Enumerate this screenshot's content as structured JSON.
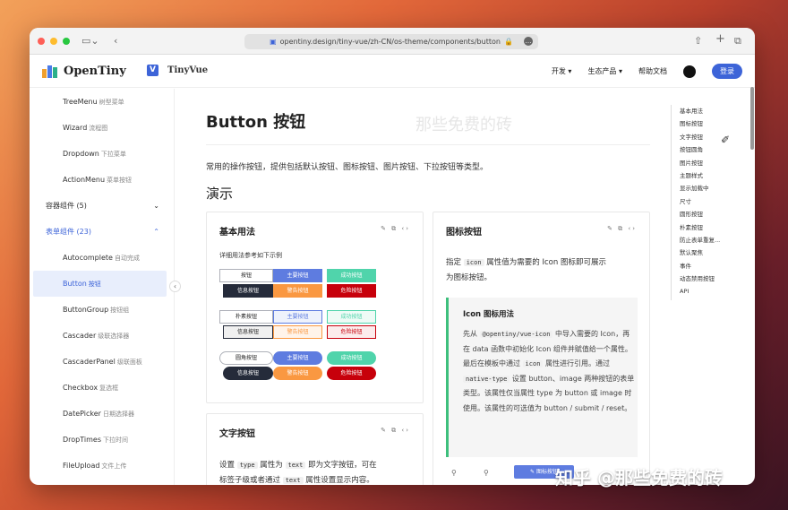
{
  "browser": {
    "url": "opentiny.design/tiny-vue/zh-CN/os-theme/components/button"
  },
  "topnav": {
    "brand": "OpenTiny",
    "product": "TinyVue",
    "items": [
      "开发",
      "生态产品",
      "帮助文档"
    ],
    "login": "登录"
  },
  "sidebar": {
    "items": [
      {
        "en": "TreeMenu",
        "cn": "树型菜单",
        "type": "item"
      },
      {
        "en": "Wizard",
        "cn": "流程图",
        "type": "item"
      },
      {
        "en": "Dropdown",
        "cn": "下拉菜单",
        "type": "item"
      },
      {
        "en": "ActionMenu",
        "cn": "菜单按钮",
        "type": "item"
      },
      {
        "en": "容器组件 (5)",
        "cn": "",
        "type": "group"
      },
      {
        "en": "表单组件 (23)",
        "cn": "",
        "type": "group-open"
      },
      {
        "en": "Autocomplete",
        "cn": "自动完成",
        "type": "item"
      },
      {
        "en": "Button",
        "cn": "按钮",
        "type": "active"
      },
      {
        "en": "ButtonGroup",
        "cn": "按钮组",
        "type": "item"
      },
      {
        "en": "Cascader",
        "cn": "级联选择器",
        "type": "item"
      },
      {
        "en": "CascaderPanel",
        "cn": "级联面板",
        "type": "item"
      },
      {
        "en": "Checkbox",
        "cn": "复选框",
        "type": "item"
      },
      {
        "en": "DatePicker",
        "cn": "日期选择器",
        "type": "item"
      },
      {
        "en": "DropTimes",
        "cn": "下拉时间",
        "type": "item"
      },
      {
        "en": "FileUpload",
        "cn": "文件上传",
        "type": "item"
      }
    ]
  },
  "main": {
    "title": "Button 按钮",
    "watermark": "那些免费的砖",
    "description": "常用的操作按钮，提供包括默认按钮、图标按钮、图片按钮、下拉按钮等类型。",
    "demo_heading": "演示",
    "card_basic": {
      "title": "基本用法",
      "subtitle": "详细用法参考如下示例",
      "row_labels": [
        "按钮",
        "主要按钮",
        "成功按钮",
        "信息按钮",
        "警告按钮",
        "危险按钮"
      ],
      "plain_labels": [
        "朴素按钮",
        "主要按钮",
        "成功按钮",
        "信息按钮",
        "警告按钮",
        "危险按钮"
      ],
      "round_labels": [
        "圆角按钮",
        "主要按钮",
        "成功按钮",
        "信息按钮",
        "警告按钮",
        "危险按钮"
      ]
    },
    "card_text": {
      "title": "文字按钮",
      "p1": "设置",
      "code1": "type",
      "p2": "属性为",
      "code2": "text",
      "p3": "即为文字按钮，可在",
      "p4": "标签子级或者通过",
      "code3": "text",
      "p5": "属性设置显示内容。"
    },
    "card_icon": {
      "title": "图标按钮",
      "p1": "指定",
      "code1": "icon",
      "p2": "属性值为需要的 Icon 图标即可展示",
      "p3": "为图标按钮。",
      "tip_title": "Icon 图标用法",
      "tip_a": "先从",
      "tip_code1": "@opentiny/vue-icon",
      "tip_b": "中导入需要的 Icon，再在 data 函数中初始化 Icon 组件并赋值给一个属性。最后在模板中通过",
      "tip_code2": "icon",
      "tip_c": "属性进行引用。通过",
      "tip_code3": "native-type",
      "tip_d": "设置 button、image 两种按钮的表单类型。该属性仅当属性 type 为 button 或 image 时使用。该属性的可选值为 button / submit / reset。",
      "icon_btn": "图标按钮"
    }
  },
  "toc": [
    "基本用法",
    "图标按钮",
    "文字按钮",
    "按钮圆角",
    "图片按钮",
    "主题样式",
    "显示加载中",
    "尺寸",
    "圆形按钮",
    "朴素按钮",
    "防止表单重复...",
    "默认聚焦",
    "事件",
    "动态禁用按钮",
    "API"
  ],
  "overlay": {
    "watermark": "知乎 @那些免费的砖"
  },
  "colors": {
    "primary": "#5e7ce0",
    "success": "#50d4ab",
    "info": "#252b3a",
    "warning": "#fa9841",
    "danger": "#c7000b"
  }
}
